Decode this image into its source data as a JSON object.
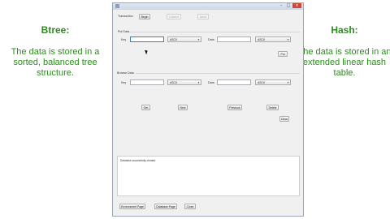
{
  "left_panel": {
    "title": "Btree:",
    "description": "The data is stored in a sorted, balanced tree structure."
  },
  "right_panel": {
    "title": "Hash:",
    "description": "The data is stored in an extended linear hash table."
  },
  "window": {
    "tab_label": "Transaction",
    "begin_button": "Begin",
    "commit_button": "Commit",
    "abort_button": "Abort",
    "put_section_label": "Put Data",
    "put_key_label": "Key",
    "put_key_value": "",
    "put_key_encoding": "ASCII",
    "put_data_label": "Data",
    "put_data_value": "",
    "put_data_encoding": "ASCII",
    "put_button": "Put",
    "browse_section_label": "Browse Data",
    "browse_key_label": "Key",
    "browse_key_encoding": "ASCII",
    "browse_data_label": "Data",
    "browse_data_encoding": "ASCII",
    "get_button": "Get",
    "next_button": "Next",
    "previous_button": "Previous",
    "delete_button": "Delete",
    "clear_button": "Clear",
    "status_text": "Database successfully created",
    "environment_page_button": "Environment Page",
    "database_page_button": "Database Page",
    "close_button": "Close"
  },
  "colors": {
    "side_text": "#2e8b1f",
    "window_bg": "#f0f0f0",
    "close_control": "#c94a3d"
  },
  "icons": {
    "app_icon": "app-icon",
    "minimize": "minimize-icon",
    "maximize": "maximize-icon",
    "close": "close-icon",
    "dropdown": "chevron-down-icon",
    "cursor": "mouse-cursor-icon"
  }
}
